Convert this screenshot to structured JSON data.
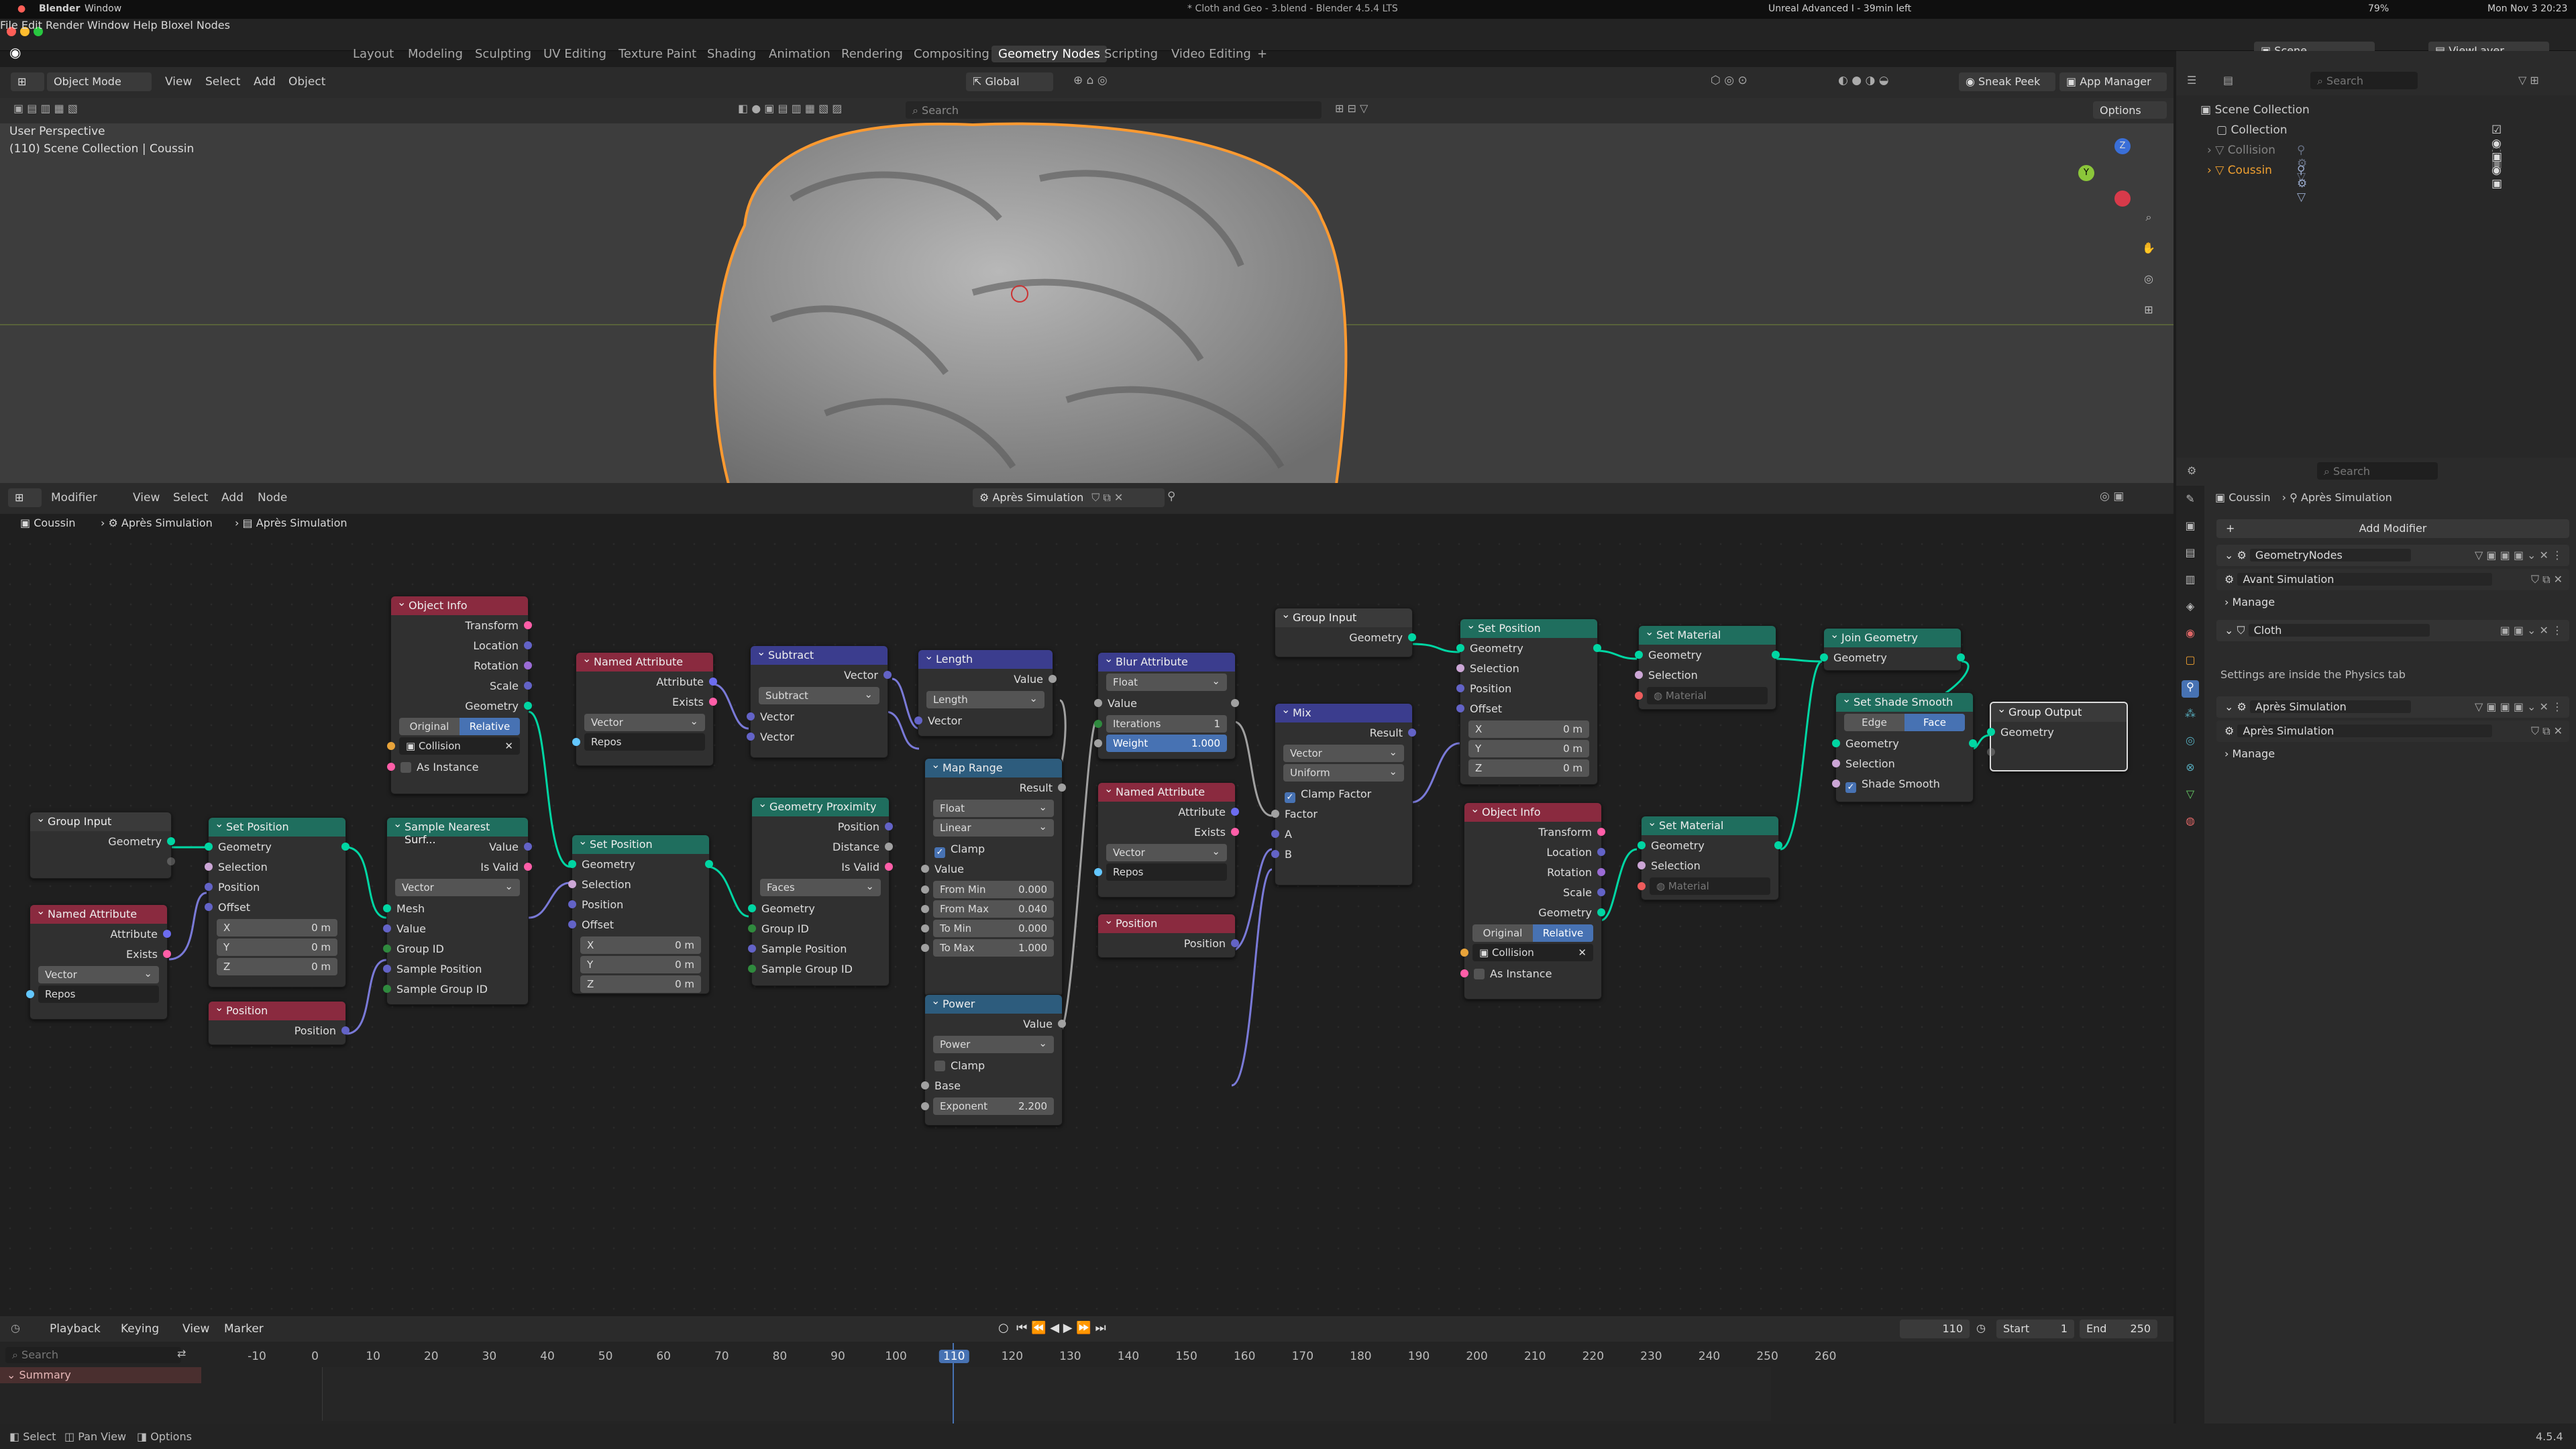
{
  "menubar": {
    "app": "Blender",
    "window": "Window",
    "title": "* Cloth and Geo - 3.blend - Blender 4.5.4 LTS",
    "status_text": "Unreal Advanced I - 39min left",
    "battery": "79%",
    "clock": "Mon Nov 3 20:23"
  },
  "topmenu": [
    "File",
    "Edit",
    "Render",
    "Window",
    "Help",
    "Bloxel Nodes"
  ],
  "workspaces": [
    "Layout",
    "Modeling",
    "Sculpting",
    "UV Editing",
    "Texture Paint",
    "Shading",
    "Animation",
    "Rendering",
    "Compositing",
    "Geometry Nodes",
    "Scripting",
    "Video Editing"
  ],
  "scene": {
    "label": "Scene",
    "viewlayer": "ViewLayer"
  },
  "viewport": {
    "mode": "Object Mode",
    "menus": [
      "View",
      "Select",
      "Add",
      "Object"
    ],
    "transform": "Global",
    "perspective": "User Perspective",
    "collection_line": "(110) Scene Collection | Coussin",
    "search_placeholder": "Search",
    "sneak_peek": "Sneak Peek",
    "app_manager": "App Manager",
    "options": "Options"
  },
  "node_editor": {
    "editor": "Modifier",
    "menus": [
      "View",
      "Select",
      "Add",
      "Node"
    ],
    "tree_name": "Après Simulation",
    "breadcrumb": [
      "Coussin",
      "Après Simulation",
      "Après Simulation"
    ]
  },
  "nodes": {
    "group_input_1": {
      "title": "Group Input",
      "geometry": "Geometry"
    },
    "named_attr_1": {
      "title": "Named Attribute",
      "attribute": "Attribute",
      "exists": "Exists",
      "type": "Vector",
      "name": "Repos"
    },
    "set_position_1": {
      "title": "Set Position",
      "geometry": "Geometry",
      "selection": "Selection",
      "position": "Position",
      "offset": "Offset",
      "x": "X",
      "y": "Y",
      "z": "Z",
      "xv": "0 m",
      "yv": "0 m",
      "zv": "0 m"
    },
    "position_1": {
      "title": "Position",
      "position": "Position"
    },
    "object_info_1": {
      "title": "Object Info",
      "transform": "Transform",
      "location": "Location",
      "rotation": "Rotation",
      "scale": "Scale",
      "geometry": "Geometry",
      "original": "Original",
      "relative": "Relative",
      "object": "Collision",
      "as_instance": "As Instance"
    },
    "sample_nearest": {
      "title": "Sample Nearest Surf...",
      "value": "Value",
      "is_valid": "Is Valid",
      "type": "Vector",
      "mesh": "Mesh",
      "value_in": "Value",
      "group_id": "Group ID",
      "sample_position": "Sample Position",
      "sample_group_id": "Sample Group ID"
    },
    "named_attr_2": {
      "title": "Named Attribute",
      "attribute": "Attribute",
      "exists": "Exists",
      "type": "Vector",
      "name": "Repos"
    },
    "set_position_2": {
      "title": "Set Position",
      "geometry": "Geometry",
      "selection": "Selection",
      "position": "Position",
      "offset": "Offset",
      "x": "X",
      "y": "Y",
      "z": "Z",
      "xv": "0 m",
      "yv": "0 m",
      "zv": "0 m"
    },
    "subtract": {
      "title": "Subtract",
      "vector": "Vector",
      "op": "Subtract",
      "in1": "Vector",
      "in2": "Vector"
    },
    "geo_prox": {
      "title": "Geometry Proximity",
      "position": "Position",
      "distance": "Distance",
      "is_valid": "Is Valid",
      "mode": "Faces",
      "geometry": "Geometry",
      "group_id": "Group ID",
      "sample_position": "Sample Position",
      "sample_group_id": "Sample Group ID"
    },
    "length": {
      "title": "Length",
      "value": "Value",
      "op": "Length",
      "vector": "Vector"
    },
    "map_range": {
      "title": "Map Range",
      "result": "Result",
      "dtype": "Float",
      "interp": "Linear",
      "clamp": "Clamp",
      "value": "Value",
      "from_min": "From Min",
      "from_min_v": "0.000",
      "from_max": "From Max",
      "from_max_v": "0.040",
      "to_min": "To Min",
      "to_min_v": "0.000",
      "to_max": "To Max",
      "to_max_v": "1.000"
    },
    "power": {
      "title": "Power",
      "value": "Value",
      "op": "Power",
      "clamp": "Clamp",
      "base": "Base",
      "exponent": "Exponent",
      "exponent_v": "2.200"
    },
    "blur": {
      "title": "Blur Attribute",
      "dtype": "Float",
      "value": "Value",
      "iterations": "Iterations",
      "iterations_v": "1",
      "weight": "Weight",
      "weight_v": "1.000"
    },
    "named_attr_3": {
      "title": "Named Attribute",
      "attribute": "Attribute",
      "exists": "Exists",
      "type": "Vector",
      "name": "Repos"
    },
    "position_2": {
      "title": "Position",
      "position": "Position"
    },
    "group_input_2": {
      "title": "Group Input",
      "geometry": "Geometry"
    },
    "mix": {
      "title": "Mix",
      "result": "Result",
      "dtype": "Vector",
      "mode": "Uniform",
      "clamp": "Clamp Factor",
      "factor": "Factor",
      "a": "A",
      "b": "B"
    },
    "set_position_3": {
      "title": "Set Position",
      "geometry": "Geometry",
      "selection": "Selection",
      "position": "Position",
      "offset": "Offset",
      "x": "X",
      "y": "Y",
      "z": "Z",
      "xv": "0 m",
      "yv": "0 m",
      "zv": "0 m"
    },
    "object_info_2": {
      "title": "Object Info",
      "transform": "Transform",
      "location": "Location",
      "rotation": "Rotation",
      "scale": "Scale",
      "geometry": "Geometry",
      "original": "Original",
      "relative": "Relative",
      "object": "Collision",
      "as_instance": "As Instance"
    },
    "set_material_1": {
      "title": "Set Material",
      "geometry": "Geometry",
      "selection": "Selection",
      "material": "Material"
    },
    "set_material_2": {
      "title": "Set Material",
      "geometry": "Geometry",
      "selection": "Selection",
      "material": "Material"
    },
    "join": {
      "title": "Join Geometry",
      "geometry": "Geometry"
    },
    "shade_smooth": {
      "title": "Set Shade Smooth",
      "edge": "Edge",
      "face": "Face",
      "geometry": "Geometry",
      "selection": "Selection",
      "shade_smooth": "Shade Smooth"
    },
    "group_output": {
      "title": "Group Output",
      "geometry": "Geometry"
    }
  },
  "timeline": {
    "menus": [
      "Playback",
      "Keying",
      "View",
      "Marker"
    ],
    "current": "110",
    "start_label": "Start",
    "start": "1",
    "end_label": "End",
    "end": "250",
    "search_placeholder": "Search",
    "summary": "Summary",
    "ticks": [
      "-10",
      "0",
      "10",
      "20",
      "30",
      "40",
      "50",
      "60",
      "70",
      "80",
      "90",
      "100",
      "110",
      "120",
      "130",
      "140",
      "150",
      "160",
      "170",
      "180",
      "190",
      "200",
      "210",
      "220",
      "230",
      "240",
      "250",
      "260"
    ]
  },
  "status": {
    "select": "Select",
    "pan": "Pan View",
    "options": "Options",
    "version": "4.5.4"
  },
  "outliner": {
    "search_placeholder": "Search",
    "scene_collection": "Scene Collection",
    "items": [
      "Collection",
      "Collision",
      "Coussin"
    ]
  },
  "properties": {
    "search_placeholder": "Search",
    "breadcrumb_obj": "Coussin",
    "breadcrumb_mod": "Après Simulation",
    "add_modifier": "Add Modifier",
    "mod1": "GeometryNodes",
    "mod1_tree": "Avant Simulation",
    "manage": "Manage",
    "cloth": "Cloth",
    "cloth_note": "Settings are inside the Physics tab",
    "mod3": "Après Simulation",
    "mod3_tree": "Après Simulation",
    "manage2": "Manage"
  }
}
